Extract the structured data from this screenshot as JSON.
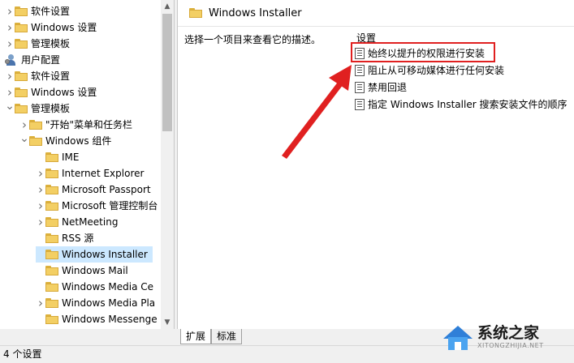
{
  "tree": {
    "items": [
      {
        "label": "软件设置",
        "icon": "folder",
        "chevron": "right",
        "indent": 0
      },
      {
        "label": "Windows 设置",
        "icon": "folder",
        "chevron": "right",
        "indent": 0
      },
      {
        "label": "管理模板",
        "icon": "folder",
        "chevron": "right",
        "indent": 0
      },
      {
        "label": "用户配置",
        "icon": "user-config",
        "chevron": "none",
        "indent": -1
      },
      {
        "label": "软件设置",
        "icon": "folder",
        "chevron": "right",
        "indent": 0
      },
      {
        "label": "Windows 设置",
        "icon": "folder",
        "chevron": "right",
        "indent": 0
      },
      {
        "label": "管理模板",
        "icon": "folder",
        "chevron": "down",
        "indent": 0
      },
      {
        "label": "\"开始\"菜单和任务栏",
        "icon": "folder",
        "chevron": "right",
        "indent": 1
      },
      {
        "label": "Windows 组件",
        "icon": "folder",
        "chevron": "down",
        "indent": 1
      },
      {
        "label": "IME",
        "icon": "folder",
        "chevron": "none",
        "indent": 2
      },
      {
        "label": "Internet Explorer",
        "icon": "folder",
        "chevron": "right",
        "indent": 2
      },
      {
        "label": "Microsoft Passport",
        "icon": "folder",
        "chevron": "right",
        "indent": 2
      },
      {
        "label": "Microsoft 管理控制台",
        "icon": "folder",
        "chevron": "right",
        "indent": 2
      },
      {
        "label": "NetMeeting",
        "icon": "folder",
        "chevron": "right",
        "indent": 2
      },
      {
        "label": "RSS 源",
        "icon": "folder",
        "chevron": "none",
        "indent": 2
      },
      {
        "label": "Windows Installer",
        "icon": "folder",
        "chevron": "none",
        "indent": 2,
        "selected": true
      },
      {
        "label": "Windows Mail",
        "icon": "folder",
        "chevron": "none",
        "indent": 2
      },
      {
        "label": "Windows Media Ce",
        "icon": "folder",
        "chevron": "none",
        "indent": 2
      },
      {
        "label": "Windows Media Pla",
        "icon": "folder",
        "chevron": "right",
        "indent": 2
      },
      {
        "label": "Windows Messenge",
        "icon": "folder",
        "chevron": "none",
        "indent": 2
      }
    ]
  },
  "details": {
    "title": "Windows Installer",
    "description": "选择一个项目来查看它的描述。",
    "settings_header": "设置",
    "settings": [
      {
        "label": "始终以提升的权限进行安装",
        "highlighted": true
      },
      {
        "label": "阻止从可移动媒体进行任何安装"
      },
      {
        "label": "禁用回退"
      },
      {
        "label": "指定 Windows Installer 搜索安装文件的顺序"
      }
    ]
  },
  "tabs": {
    "extended": "扩展",
    "standard": "标准"
  },
  "status": {
    "text": "4 个设置"
  },
  "watermark": {
    "name": "系统之家",
    "url": "XITONGZHIJIA.NET"
  },
  "colors": {
    "annotation": "#e02020",
    "selection": "#cce8ff",
    "folder": "#f3cf64"
  }
}
